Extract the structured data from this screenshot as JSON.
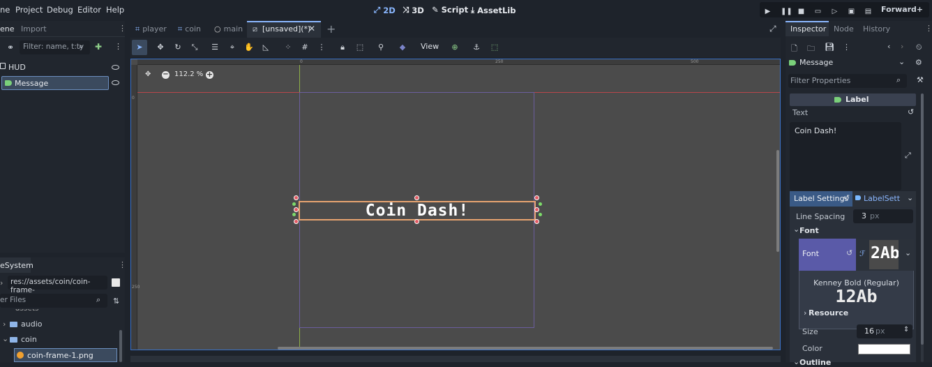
{
  "menu": {
    "scene": "ne",
    "project": "Project",
    "debug": "Debug",
    "editor": "Editor",
    "help": "Help"
  },
  "modes": {
    "d2": "2D",
    "d3": "3D",
    "script": "Script",
    "assetlib": "AssetLib"
  },
  "renderer": "Forward+",
  "scene_panel": {
    "tab_scene": "ene",
    "tab_import": "Import",
    "filter_placeholder": "Filter: name, t:ty",
    "nodes": [
      {
        "name": "HUD"
      },
      {
        "name": "Message"
      }
    ]
  },
  "filesystem": {
    "tab": "eSystem",
    "path": "res://assets/coin/coin-frame-",
    "filter_placeholder": "er Files",
    "items": [
      {
        "name": "assets"
      },
      {
        "name": "audio"
      },
      {
        "name": "coin"
      },
      {
        "name": "coin-frame-1.png"
      }
    ]
  },
  "editor_tabs": [
    {
      "label": "player"
    },
    {
      "label": "coin"
    },
    {
      "label": "main"
    },
    {
      "label": "[unsaved](*)"
    }
  ],
  "toolbar": {
    "view": "View"
  },
  "viewport": {
    "zoom": "112.2 %",
    "label_text": "Coin Dash!",
    "ruler_h": [
      "0",
      "250",
      "500"
    ],
    "ruler_v": [
      "0",
      "250"
    ]
  },
  "inspector": {
    "tabs": {
      "inspector": "Inspector",
      "node": "Node",
      "history": "History"
    },
    "node_name": "Message",
    "filter_placeholder": "Filter Properties",
    "class_header": "Label",
    "text_label": "Text",
    "text_value": "Coin Dash!",
    "label_settings": "Label Settings",
    "labelsett": "LabelSett",
    "line_spacing_label": "Line Spacing",
    "line_spacing_value": "3",
    "unit_px": "px",
    "font_section": "Font",
    "font_label": "Font",
    "font_preview": "2Ab",
    "font_name": "Kenney Bold (Regular)",
    "font_sample": "12Ab",
    "resource": "Resource",
    "size_label": "Size",
    "size_value": "16",
    "color_label": "Color",
    "outline": "Outline"
  },
  "colors": {
    "accent": "#8ab7ff",
    "selected": "#3b4a5e",
    "viewport_bg": "#4b4b4b",
    "forward": "#7ac46b"
  }
}
